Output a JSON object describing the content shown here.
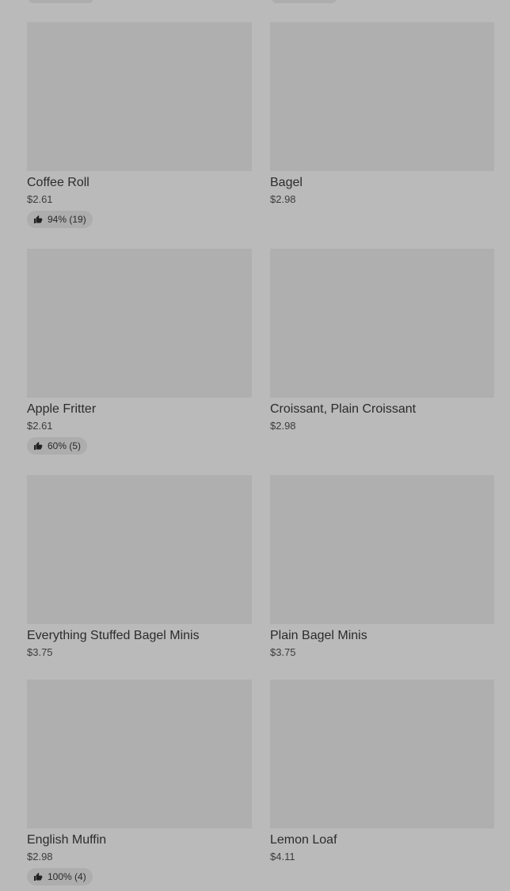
{
  "products": [
    {
      "name": "Coffee Roll",
      "price": "$2.61",
      "rating": "94% (19)"
    },
    {
      "name": "Bagel",
      "price": "$2.98",
      "rating": ""
    },
    {
      "name": "Apple Fritter",
      "price": "$2.61",
      "rating": "60% (5)"
    },
    {
      "name": "Croissant, Plain Croissant",
      "price": "$2.98",
      "rating": ""
    },
    {
      "name": "Everything Stuffed Bagel Minis",
      "price": "$3.75",
      "rating": ""
    },
    {
      "name": "Plain Bagel Minis",
      "price": "$3.75",
      "rating": ""
    },
    {
      "name": "English Muffin",
      "price": "$2.98",
      "rating": "100% (4)"
    },
    {
      "name": "Lemon Loaf",
      "price": "$4.11",
      "rating": ""
    }
  ],
  "icons": {
    "rating": "thumbs-up-icon"
  },
  "colors": {
    "background": "#bababa",
    "thumbnail": "#afafaf",
    "badge": "#adadad"
  }
}
